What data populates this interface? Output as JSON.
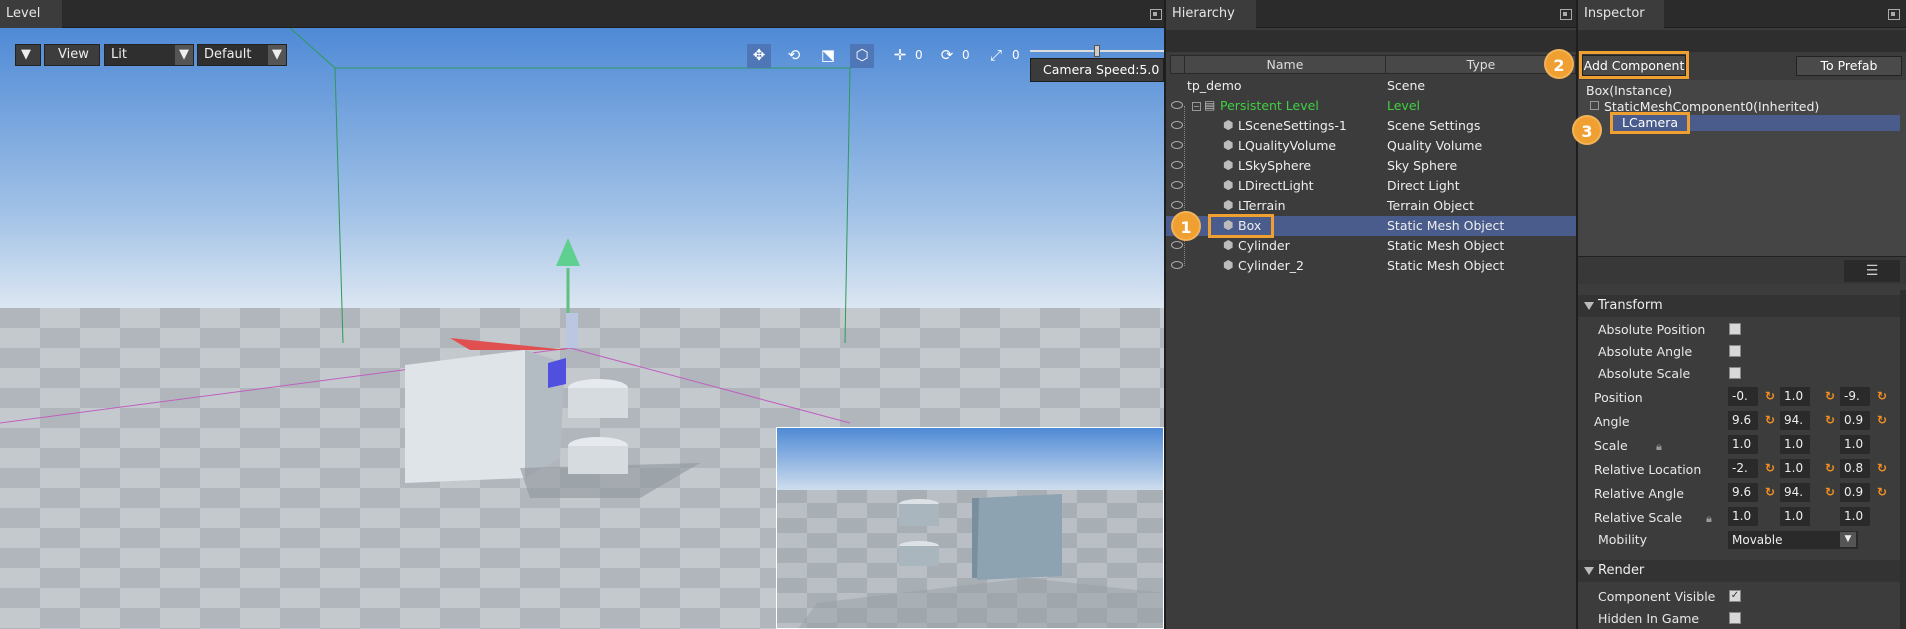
{
  "level_panel": {
    "tab": "Level"
  },
  "viewport": {
    "view_label": "View",
    "shading_value": "Lit",
    "layout_value": "Default",
    "tool_counts": [
      "0",
      "0",
      "0"
    ],
    "camera_speed": "Camera Speed:5.0"
  },
  "hierarchy": {
    "tab": "Hierarchy",
    "col_name": "Name",
    "col_type": "Type",
    "rows": [
      {
        "name": "tp_demo",
        "type": "Scene"
      },
      {
        "name": "Persistent Level",
        "type": "Level"
      },
      {
        "name": "LSceneSettings-1",
        "type": "Scene Settings"
      },
      {
        "name": "LQualityVolume",
        "type": "Quality Volume"
      },
      {
        "name": "LSkySphere",
        "type": "Sky Sphere"
      },
      {
        "name": "LDirectLight",
        "type": "Direct Light"
      },
      {
        "name": "LTerrain",
        "type": "Terrain Object"
      },
      {
        "name": "Box",
        "type": "Static Mesh Object"
      },
      {
        "name": "Cylinder",
        "type": "Static Mesh Object"
      },
      {
        "name": "Cylinder_2",
        "type": "Static Mesh Object"
      }
    ]
  },
  "inspector": {
    "tab": "Inspector",
    "add_component": "Add Component",
    "to_prefab": "To Prefab",
    "tree": {
      "root": "Box(Instance)",
      "component": "StaticMeshComponent0(Inherited)",
      "camera": "LCamera"
    },
    "transform": {
      "title": "Transform",
      "absolute_position": "Absolute Position",
      "absolute_angle": "Absolute Angle",
      "absolute_scale": "Absolute Scale",
      "position": {
        "label": "Position",
        "values": [
          "-0.",
          "1.0",
          "-9."
        ]
      },
      "angle": {
        "label": "Angle",
        "values": [
          "9.6",
          "94.",
          "0.9"
        ]
      },
      "scale": {
        "label": "Scale",
        "values": [
          "1.0",
          "1.0",
          "1.0"
        ]
      },
      "relative_location": {
        "label": "Relative Location",
        "values": [
          "-2.",
          "1.0",
          "0.8"
        ]
      },
      "relative_angle": {
        "label": "Relative Angle",
        "values": [
          "9.6",
          "94.",
          "0.9"
        ]
      },
      "relative_scale": {
        "label": "Relative Scale",
        "values": [
          "1.0",
          "1.0",
          "1.0"
        ]
      },
      "mobility_label": "Mobility",
      "mobility_value": "Movable"
    },
    "render": {
      "title": "Render",
      "component_visible": "Component Visible",
      "hidden_in_game": "Hidden In Game"
    }
  },
  "badges": [
    "1",
    "2",
    "3"
  ],
  "colors": {
    "accent": "#f0a030",
    "selection": "#4a5c8c",
    "level_green": "#40d040"
  }
}
